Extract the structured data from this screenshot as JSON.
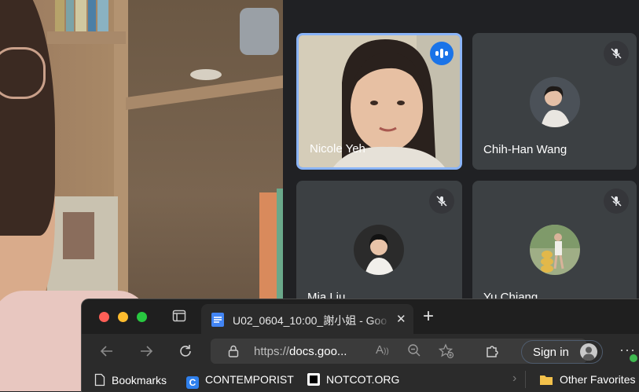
{
  "meeting": {
    "participants": [
      {
        "name": "Nicole Yeh",
        "speaking": true,
        "muted": false
      },
      {
        "name": "Chih-Han Wang",
        "speaking": false,
        "muted": true
      },
      {
        "name": "Mia Liu",
        "speaking": false,
        "muted": true
      },
      {
        "name": "Yu Chiang",
        "speaking": false,
        "muted": true
      }
    ]
  },
  "browser": {
    "tab": {
      "title": "U02_0604_10:00_謝小姐 - Goo",
      "close": "✕",
      "new_tab": "+"
    },
    "address": {
      "prefix": "https://",
      "host": "docs.goo...",
      "": ""
    },
    "sign_in_label": "Sign in",
    "more": "···",
    "bookmarks": [
      {
        "label": "Bookmarks",
        "icon": "document-icon"
      },
      {
        "label": "CONTEMPORIST",
        "icon": "c-logo-icon"
      },
      {
        "label": "NOTCOT.ORG",
        "icon": "notcot-logo-icon"
      }
    ],
    "other_favorites": "Other Favorites"
  },
  "colors": {
    "active_border": "#8ab4f8",
    "speaking_badge": "#1a73e8",
    "tile_bg": "#3c4043",
    "grid_bg": "#202124"
  }
}
